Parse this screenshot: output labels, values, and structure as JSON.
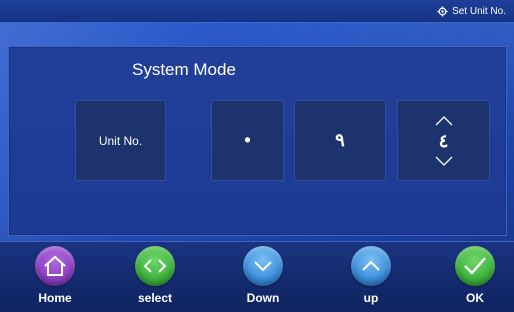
{
  "header": {
    "set_unit_label": "Set Unit No.",
    "set_unit_icon": "gear-icon"
  },
  "main": {
    "title": "System Mode",
    "unit_label": "Unit No.",
    "digits": [
      "•",
      "٩",
      "٤"
    ]
  },
  "nav": {
    "home": {
      "label": "Home",
      "icon": "home-icon",
      "color": "#8b3fc4"
    },
    "select": {
      "label": "select",
      "icon": "left-right-chevrons-icon",
      "color": "#3db43d"
    },
    "down": {
      "label": "Down",
      "icon": "chevron-down-icon",
      "color": "#3a8fdc"
    },
    "up": {
      "label": "up",
      "icon": "chevron-up-icon",
      "color": "#3a8fdc"
    },
    "ok": {
      "label": "OK",
      "icon": "checkmark-icon",
      "color": "#3db43d"
    }
  }
}
